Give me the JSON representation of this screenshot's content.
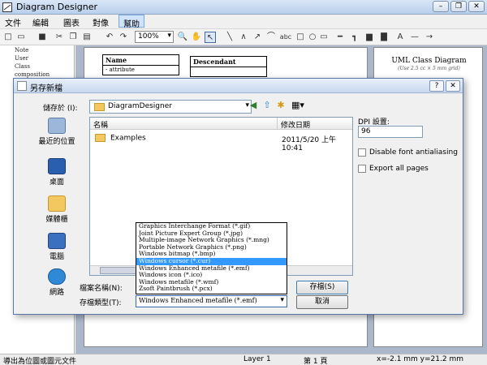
{
  "window": {
    "title": "Diagram Designer"
  },
  "menu": [
    "文件",
    "編輯",
    "圖表",
    "對像",
    "幫助"
  ],
  "toolbar": {
    "zoom": "100%",
    "text_tool": "abc"
  },
  "tree": [
    "Note",
    "User",
    "Class",
    "composition"
  ],
  "canvas": {
    "class_a": {
      "name": "Name",
      "attr": "- attribute"
    },
    "class_b": {
      "name": "Descendant"
    },
    "uml_title": "UML Class Diagram",
    "uml_subtitle": "(Use 2.5 cc × 5 mm grid)"
  },
  "dialog": {
    "title": "另存新檔",
    "save_in_label": "儲存於 (I):",
    "save_in_value": "DiagramDesigner",
    "places": [
      "最近的位置",
      "桌面",
      "媒體櫃",
      "電腦",
      "網路"
    ],
    "columns": {
      "name": "名稱",
      "date": "修改日期"
    },
    "files": [
      {
        "name": "Examples",
        "date": "2011/5/20 上午 10:41"
      }
    ],
    "dpi_label": "DPI 設置:",
    "dpi_value": "96",
    "disable_antialias": "Disable font antialiasing",
    "export_all": "Export all pages",
    "filename_label": "檔案名稱(N):",
    "filetype_label": "存檔類型(T):",
    "filetype_value": "Windows Enhanced metafile (*.emf)",
    "save_button": "存檔(S)",
    "cancel_button": "取消",
    "filetype_options": [
      "Graphics Interchange Format (*.gif)",
      "Joint Picture Expert Group (*.jpg)",
      "Multiple-image Network Graphics (*.mng)",
      "Portable Network Graphics (*.png)",
      "Windows bitmap (*.bmp)",
      "Windows cursor (*.cur)",
      "Windows Enhanced metafile (*.emf)",
      "Windows icon (*.ico)",
      "Windows metafile (*.wmf)",
      "Zsoft Paintbrush (*.pcx)"
    ],
    "filetype_selected_index": 5
  },
  "status": {
    "hint": "導出為位圖或圖元文件",
    "layer": "Layer 1",
    "page": "第 1 頁",
    "coords": "x=-2.1 mm  y=21.2 mm"
  }
}
